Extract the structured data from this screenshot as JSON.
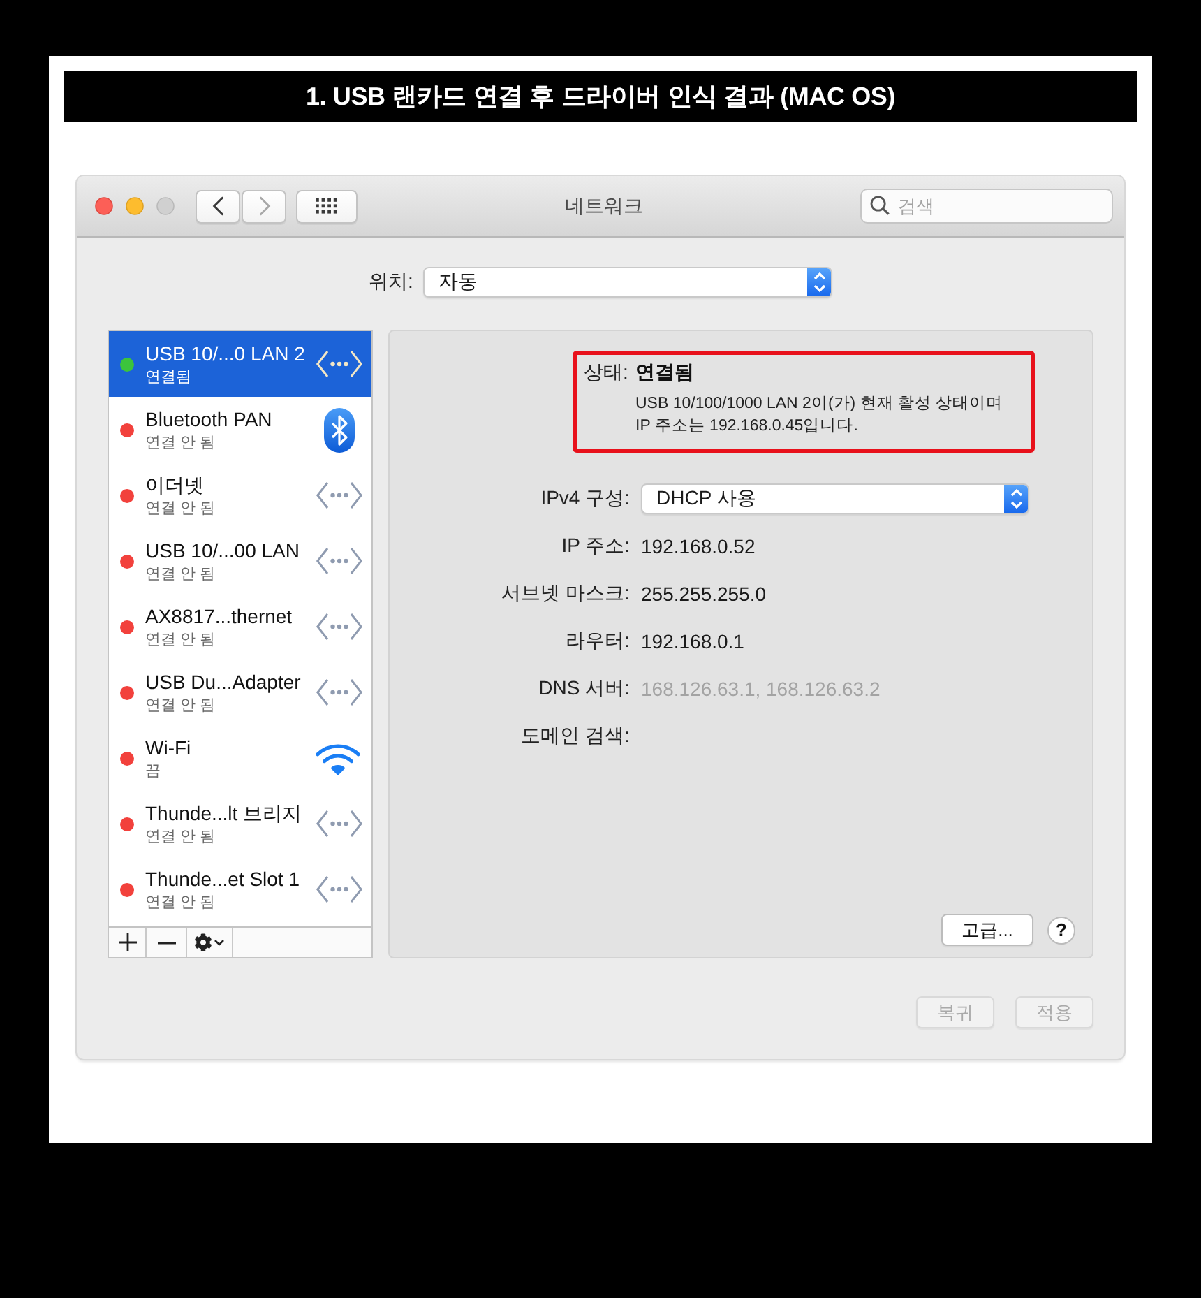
{
  "banner": {
    "title": "1. USB 랜카드 연결 후 드라이버 인식 결과 (MAC OS)"
  },
  "window": {
    "title": "네트워크",
    "back": {
      "disabled": false
    },
    "forward": {
      "disabled": true
    },
    "search": {
      "placeholder": "검색"
    }
  },
  "location": {
    "label": "위치:",
    "value": "자동"
  },
  "services": [
    {
      "kind": "ethernet",
      "name": "USB 10/...0 LAN 2",
      "status": "연결됨",
      "color": "#3cc43c",
      "selected": true
    },
    {
      "kind": "bluetooth",
      "name": "Bluetooth PAN",
      "status": "연결 안 됨",
      "color": "#f2413c",
      "selected": false
    },
    {
      "kind": "ethernet",
      "name": "이더넷",
      "status": "연결 안 됨",
      "color": "#f2413c",
      "selected": false
    },
    {
      "kind": "ethernet",
      "name": "USB 10/...00 LAN",
      "status": "연결 안 됨",
      "color": "#f2413c",
      "selected": false
    },
    {
      "kind": "ethernet",
      "name": "AX8817...thernet",
      "status": "연결 안 됨",
      "color": "#f2413c",
      "selected": false
    },
    {
      "kind": "ethernet",
      "name": "USB Du...Adapter",
      "status": "연결 안 됨",
      "color": "#f2413c",
      "selected": false
    },
    {
      "kind": "wifi",
      "name": "Wi-Fi",
      "status": "끔",
      "color": "#f2413c",
      "selected": false
    },
    {
      "kind": "ethernet",
      "name": "Thunde...lt 브리지",
      "status": "연결 안 됨",
      "color": "#f2413c",
      "selected": false
    },
    {
      "kind": "ethernet",
      "name": "Thunde...et Slot 1",
      "status": "연결 안 됨",
      "color": "#f2413c",
      "selected": false
    }
  ],
  "status": {
    "label": "상태:",
    "value": "연결됨",
    "description_lines": [
      "USB 10/100/1000 LAN 2이(가) 현재 활성 상태이며",
      "IP 주소는 192.168.0.45입니다."
    ],
    "highlighted": true
  },
  "fields": [
    {
      "kind": "popup",
      "label": "IPv4 구성:",
      "value": "DHCP 사용"
    },
    {
      "kind": "text",
      "label": "IP 주소:",
      "value": "192.168.0.52"
    },
    {
      "kind": "text",
      "label": "서브넷 마스크:",
      "value": "255.255.255.0"
    },
    {
      "kind": "text",
      "label": "라우터:",
      "value": "192.168.0.1"
    },
    {
      "kind": "auto",
      "label": "DNS 서버:",
      "value": "168.126.63.1, 168.126.63.2"
    },
    {
      "kind": "text",
      "label": "도메인 검색:"
    }
  ],
  "panel_buttons": {
    "advanced": "고급...",
    "help": "?"
  },
  "footer_buttons": [
    {
      "label": "복귀",
      "disabled": true
    },
    {
      "label": "적용",
      "disabled": true
    }
  ]
}
